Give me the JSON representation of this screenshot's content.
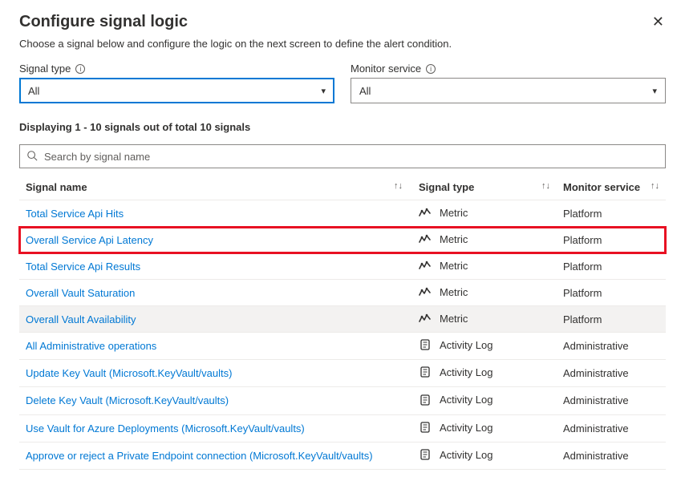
{
  "header": {
    "title": "Configure signal logic",
    "subtitle": "Choose a signal below and configure the logic on the next screen to define the alert condition."
  },
  "filters": {
    "signal_type": {
      "label": "Signal type",
      "value": "All"
    },
    "monitor_service": {
      "label": "Monitor service",
      "value": "All"
    }
  },
  "counter": "Displaying 1 - 10 signals out of total 10 signals",
  "search": {
    "placeholder": "Search by signal name"
  },
  "columns": {
    "name": "Signal name",
    "type": "Signal type",
    "service": "Monitor service"
  },
  "rows": [
    {
      "name": "Total Service Api Hits",
      "icon": "metric",
      "type": "Metric",
      "service": "Platform",
      "highlight": false,
      "hover": false
    },
    {
      "name": "Overall Service Api Latency",
      "icon": "metric",
      "type": "Metric",
      "service": "Platform",
      "highlight": true,
      "hover": false
    },
    {
      "name": "Total Service Api Results",
      "icon": "metric",
      "type": "Metric",
      "service": "Platform",
      "highlight": false,
      "hover": false
    },
    {
      "name": "Overall Vault Saturation",
      "icon": "metric",
      "type": "Metric",
      "service": "Platform",
      "highlight": false,
      "hover": false
    },
    {
      "name": "Overall Vault Availability",
      "icon": "metric",
      "type": "Metric",
      "service": "Platform",
      "highlight": false,
      "hover": true
    },
    {
      "name": "All Administrative operations",
      "icon": "activity",
      "type": "Activity Log",
      "service": "Administrative",
      "highlight": false,
      "hover": false
    },
    {
      "name": "Update Key Vault (Microsoft.KeyVault/vaults)",
      "icon": "activity",
      "type": "Activity Log",
      "service": "Administrative",
      "highlight": false,
      "hover": false
    },
    {
      "name": "Delete Key Vault (Microsoft.KeyVault/vaults)",
      "icon": "activity",
      "type": "Activity Log",
      "service": "Administrative",
      "highlight": false,
      "hover": false
    },
    {
      "name": "Use Vault for Azure Deployments (Microsoft.KeyVault/vaults)",
      "icon": "activity",
      "type": "Activity Log",
      "service": "Administrative",
      "highlight": false,
      "hover": false
    },
    {
      "name": "Approve or reject a Private Endpoint connection (Microsoft.KeyVault/vaults)",
      "icon": "activity",
      "type": "Activity Log",
      "service": "Administrative",
      "highlight": false,
      "hover": false
    }
  ],
  "icons": {
    "metric_glyph": "〳",
    "activity_glyph": "▭"
  }
}
